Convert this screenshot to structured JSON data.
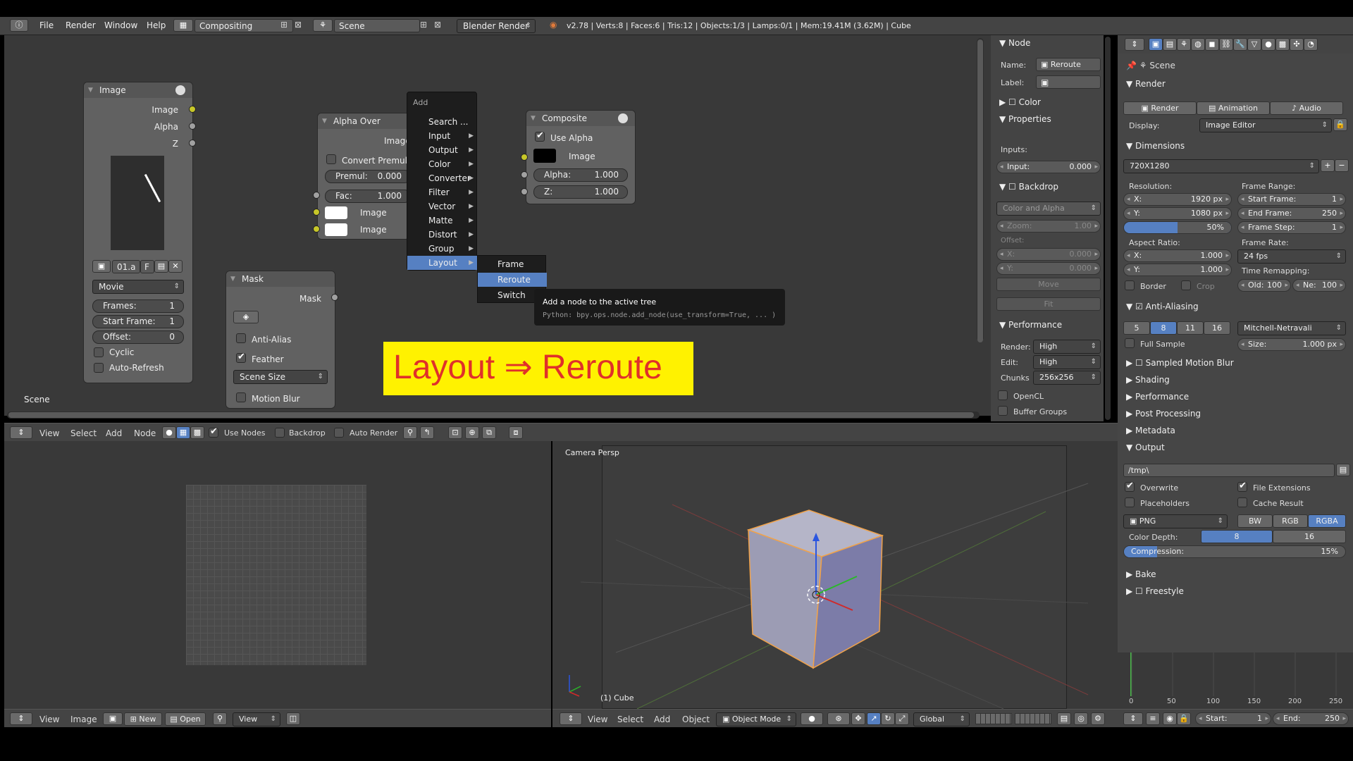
{
  "topbar": {
    "menus": [
      "File",
      "Render",
      "Window",
      "Help"
    ],
    "screen_layout": "Compositing",
    "scene": "Scene",
    "engine": "Blender Render",
    "stats": "v2.78 | Verts:8 | Faces:6 | Tris:12 | Objects:1/3 | Lamps:0/1 | Mem:19.41M (3.62M) | Cube"
  },
  "image_node": {
    "title": "Image",
    "outputs": [
      "Image",
      "Alpha",
      "Z"
    ],
    "image_name": "01.a",
    "fake_user": "F",
    "source": "Movie",
    "frames_label": "Frames:",
    "frames": "1",
    "start_label": "Start Frame:",
    "start": "1",
    "offset_label": "Offset:",
    "offset": "0",
    "cyclic": "Cyclic",
    "autorefresh": "Auto-Refresh"
  },
  "alpha_over": {
    "title": "Alpha Over",
    "out": "Image",
    "convert": "Convert Premul",
    "premul_label": "Premul:",
    "premul": "0.000",
    "fac_label": "Fac:",
    "fac": "1.000",
    "in1": "Image",
    "in2": "Image"
  },
  "composite": {
    "title": "Composite",
    "use_alpha": "Use Alpha",
    "image": "Image",
    "alpha_label": "Alpha:",
    "alpha": "1.000",
    "z_label": "Z:",
    "z": "1.000"
  },
  "mask_node": {
    "title": "Mask",
    "out": "Mask",
    "antialias": "Anti-Alias",
    "feather": "Feather",
    "size": "Scene Size",
    "motion": "Motion Blur"
  },
  "scene_label": "Scene",
  "add_menu": {
    "title": "Add",
    "items": [
      "Search ...",
      "Input",
      "Output",
      "Color",
      "Converter",
      "Filter",
      "Vector",
      "Matte",
      "Distort",
      "Group",
      "Layout"
    ],
    "sub": [
      "Frame",
      "Reroute",
      "Switch"
    ]
  },
  "tooltip": {
    "title": "Add a node to the active tree",
    "python": "Python: bpy.ops.node.add_node(use_transform=True, ... )"
  },
  "banner": "Layout ⇒ Reroute",
  "node_panel": {
    "node": "Node",
    "name_label": "Name:",
    "name": "Reroute",
    "label_label": "Label:",
    "color": "Color",
    "properties": "Properties",
    "inputs": "Inputs:",
    "input_label": "Input:",
    "input": "0.000",
    "backdrop": "Backdrop",
    "backdrop_mode": "Color and Alpha",
    "zoom_label": "Zoom:",
    "zoom": "1.00",
    "offset": "Offset:",
    "ox_label": "X:",
    "ox": "0.000",
    "oy_label": "Y:",
    "oy": "0.000",
    "move": "Move",
    "fit": "Fit",
    "performance": "Performance",
    "render_label": "Render:",
    "render": "High",
    "edit_label": "Edit:",
    "edit": "High",
    "chunks_label": "Chunks",
    "chunks": "256x256",
    "opencl": "OpenCL",
    "buffer": "Buffer Groups"
  },
  "node_header": {
    "menus": [
      "View",
      "Select",
      "Add",
      "Node"
    ],
    "use_nodes": "Use Nodes",
    "backdrop": "Backdrop",
    "auto_render": "Auto Render"
  },
  "image_header": {
    "menus": [
      "View",
      "Image"
    ],
    "new": "New",
    "open": "Open",
    "view": "View"
  },
  "viewport": {
    "label": "Camera Persp",
    "object": "(1) Cube",
    "menus": [
      "View",
      "Select",
      "Add",
      "Object"
    ],
    "mode": "Object Mode",
    "orientation": "Global"
  },
  "props": {
    "scene": "Scene",
    "render": "Render",
    "render_btn": "Render",
    "animation_btn": "Animation",
    "audio_btn": "Audio",
    "display_label": "Display:",
    "display": "Image Editor",
    "dimensions": "Dimensions",
    "preset": "720X1280",
    "resolution": "Resolution:",
    "res_x_label": "X:",
    "res_x": "1920 px",
    "res_y_label": "Y:",
    "res_y": "1080 px",
    "res_pct": "50%",
    "frame_range": "Frame Range:",
    "start_label": "Start Frame:",
    "start": "1",
    "end_label": "End Frame:",
    "end": "250",
    "step_label": "Frame Step:",
    "step": "1",
    "aspect": "Aspect Ratio:",
    "asp_x_label": "X:",
    "asp_x": "1.000",
    "asp_y_label": "Y:",
    "asp_y": "1.000",
    "frame_rate": "Frame Rate:",
    "fps": "24 fps",
    "time_remap": "Time Remapping:",
    "border": "Border",
    "crop": "Crop",
    "old_label": "Old:",
    "old": "100",
    "new_label": "Ne:",
    "new": "100",
    "aa": "Anti-Aliasing",
    "aa_samples": [
      "5",
      "8",
      "11",
      "16"
    ],
    "filter": "Mitchell-Netravali",
    "full_sample": "Full Sample",
    "size_label": "Size:",
    "size": "1.000 px",
    "sampled_mb": "Sampled Motion Blur",
    "shading": "Shading",
    "performance": "Performance",
    "post": "Post Processing",
    "metadata": "Metadata",
    "output": "Output",
    "path": "/tmp\\",
    "overwrite": "Overwrite",
    "file_ext": "File Extensions",
    "placeholders": "Placeholders",
    "cache": "Cache Result",
    "format": "PNG",
    "bw": "BW",
    "rgb": "RGB",
    "rgba": "RGBA",
    "color_depth": "Color Depth:",
    "depth8": "8",
    "depth16": "16",
    "compression_label": "Compression:",
    "compression": "15%",
    "bake": "Bake",
    "freestyle": "Freestyle"
  },
  "timeline": {
    "ticks": [
      "0",
      "50",
      "100",
      "150",
      "200",
      "250"
    ],
    "start_label": "Start:",
    "start": "1",
    "end_label": "End:",
    "end": "250"
  }
}
